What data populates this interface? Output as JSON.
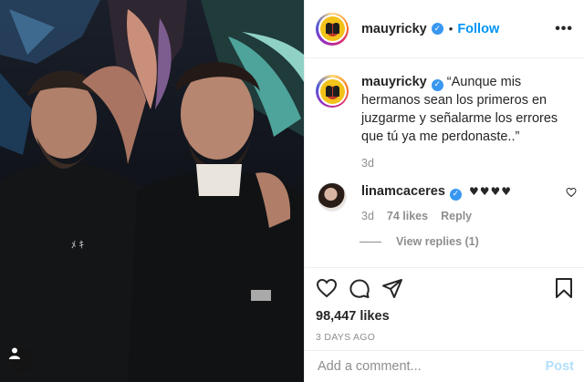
{
  "post": {
    "author": "mauyricky",
    "follow_label": "Follow",
    "separator": "•",
    "more_label": "•••",
    "caption": "“Aunque mis hermanos sean los primeros en juzgarme y señalarme los errores que tú ya me perdonaste..”",
    "caption_age": "3d",
    "likes": "98,447 likes",
    "date": "3 DAYS AGO"
  },
  "comments": [
    {
      "user": "linamcaceres",
      "text": "♥♥♥♥",
      "age": "3d",
      "likes": "74 likes",
      "reply_label": "Reply",
      "view_replies": "View replies (1)"
    }
  ],
  "compose": {
    "placeholder": "Add a comment...",
    "post_label": "Post"
  },
  "icons": {
    "like": "heart-icon",
    "comment": "comment-icon",
    "share": "share-icon",
    "save": "bookmark-icon",
    "verified": "verified-badge-icon",
    "user_tag": "user-tag-icon"
  },
  "colors": {
    "accent": "#0095f6",
    "verified": "#3897f0",
    "muted": "#8e8e8e",
    "post_disabled": "#b2dffc"
  }
}
